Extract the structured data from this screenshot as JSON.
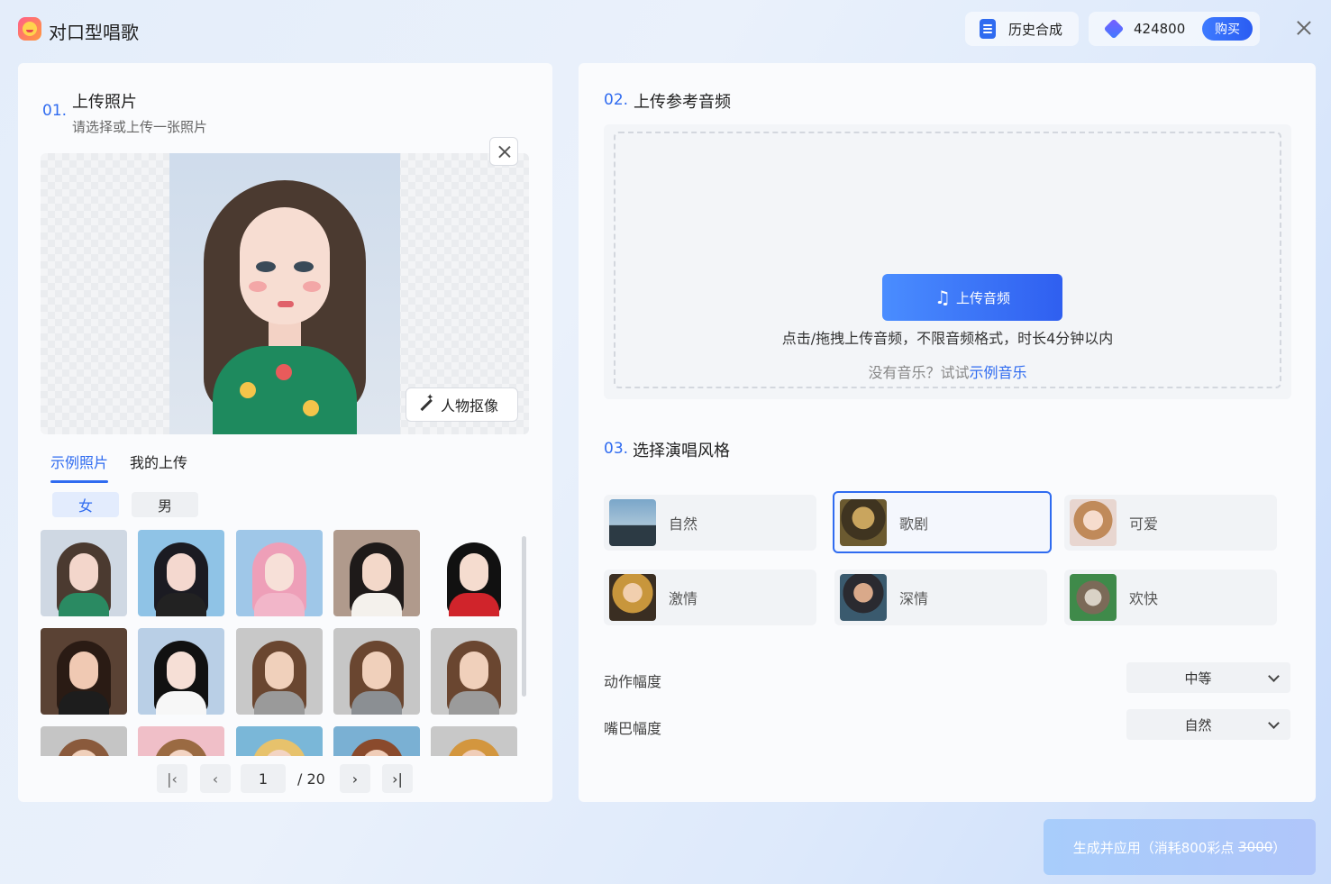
{
  "app": {
    "title": "对口型唱歌"
  },
  "header": {
    "history_label": "历史合成",
    "points": "424800",
    "buy_label": "购买"
  },
  "step1": {
    "num": "01.",
    "title": "上传照片",
    "subtitle": "请选择或上传一张照片",
    "matting_label": "人物抠像",
    "tabs": [
      {
        "label": "示例照片",
        "active": true
      },
      {
        "label": "我的上传",
        "active": false
      }
    ],
    "genders": [
      {
        "label": "女",
        "active": true
      },
      {
        "label": "男",
        "active": false
      }
    ],
    "pagination": {
      "current": "1",
      "total": "/ 20"
    }
  },
  "step2": {
    "num": "02.",
    "title": "上传参考音频",
    "upload_label": "上传音频",
    "hint": "点击/拖拽上传音频，不限音频格式，时长4分钟以内",
    "no_music": "没有音乐？试试",
    "sample_link": "示例音乐"
  },
  "step3": {
    "num": "03.",
    "title": "选择演唱风格",
    "styles": [
      {
        "label": "自然",
        "selected": false
      },
      {
        "label": "歌剧",
        "selected": true
      },
      {
        "label": "可爱",
        "selected": false
      },
      {
        "label": "激情",
        "selected": false
      },
      {
        "label": "深情",
        "selected": false
      },
      {
        "label": "欢快",
        "selected": false
      }
    ],
    "motion": {
      "label": "动作幅度",
      "value": "中等"
    },
    "mouth": {
      "label": "嘴巴幅度",
      "value": "自然"
    }
  },
  "generate": {
    "label": "生成并应用（消耗800彩点",
    "old_price": "3000",
    "suffix": "）"
  },
  "colors": {
    "accent": "#2f6bf0",
    "selected_border": "#2f6bf0"
  }
}
